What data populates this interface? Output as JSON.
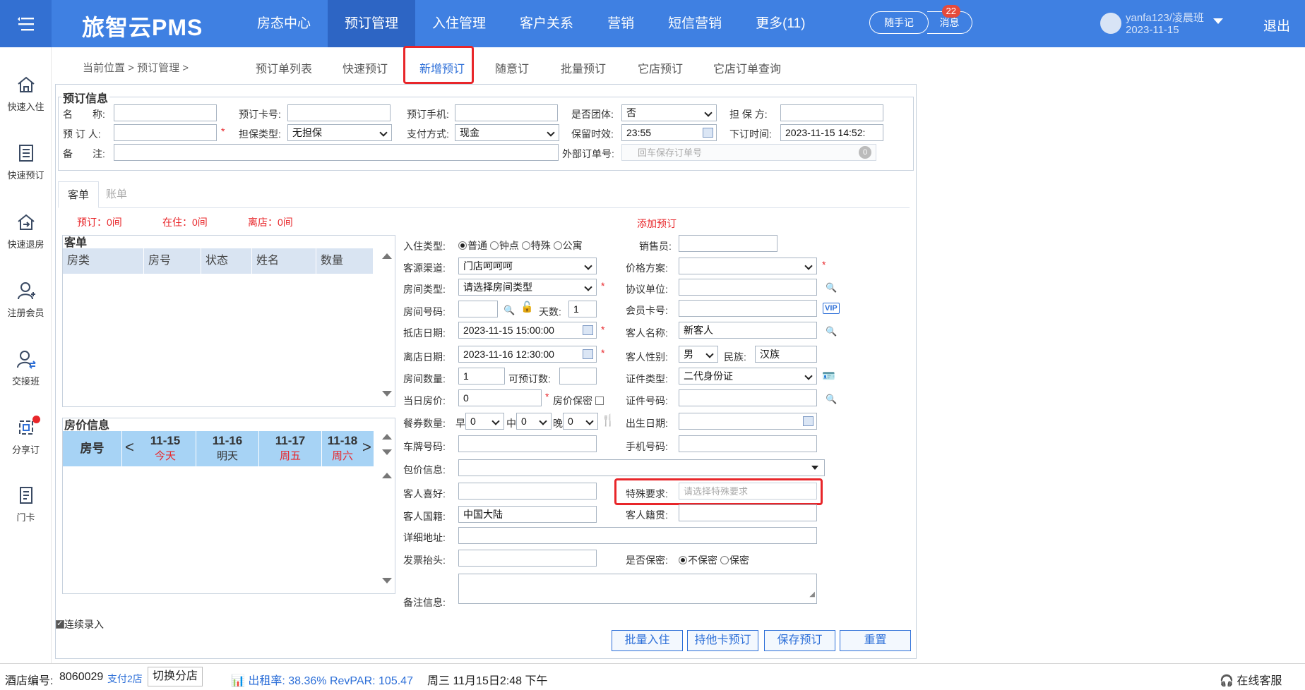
{
  "app": {
    "brand": "旅智云PMS",
    "nav": [
      "房态中心",
      "预订管理",
      "入住管理",
      "客户关系",
      "营销",
      "短信营销",
      "更多(11)"
    ],
    "active_nav": 1,
    "notes_btn": "随手记",
    "msg_btn": "消息",
    "msg_count": "22",
    "user_name": "yanfa123/凌晨班",
    "user_date": "2023-11-15",
    "logout": "退出"
  },
  "sidebar": [
    {
      "label": "快速入住",
      "icon": "home-icon"
    },
    {
      "label": "快速预订",
      "icon": "book-icon"
    },
    {
      "label": "快速退房",
      "icon": "checkout-icon"
    },
    {
      "label": "注册会员",
      "icon": "user-add-icon"
    },
    {
      "label": "交接班",
      "icon": "shift-icon"
    },
    {
      "label": "分享订",
      "icon": "share-icon"
    },
    {
      "label": "门卡",
      "icon": "card-icon"
    }
  ],
  "subnav": {
    "crumb": "当前位置 > 预订管理 >",
    "tabs": [
      "预订单列表",
      "快速预订",
      "新增预订",
      "随意订",
      "批量预订",
      "它店预订",
      "它店订单查询"
    ],
    "active": 2
  },
  "booking_info": {
    "legend": "预订信息",
    "name_label": "名　　称:",
    "card_label": "预订卡号:",
    "phone_label": "预订手机:",
    "group_label": "是否团体:",
    "group_value": "否",
    "guarantor_label": "担 保 方:",
    "booker_label": "预 订 人:",
    "guarantee_type_label": "担保类型:",
    "guarantee_type_value": "无担保",
    "payment_label": "支付方式:",
    "payment_value": "现金",
    "hold_label": "保留时效:",
    "hold_value": "23:55",
    "order_time_label": "下订时间:",
    "order_time_value": "2023-11-15 14:52:",
    "remark_label": "备　　注:",
    "external_label": "外部订单号:",
    "external_placeholder": "回车保存订单号",
    "external_count": "0"
  },
  "tabs": [
    "客单",
    "账单"
  ],
  "stats": {
    "reserved": "预订：0间",
    "in_house": "在住：0间",
    "departed": "离店：0间",
    "add_link": "添加预订"
  },
  "guest_list": {
    "title": "客单",
    "columns": [
      "房类",
      "房号",
      "状态",
      "姓名",
      "数量"
    ]
  },
  "price_info": {
    "title": "房价信息",
    "room_no": "房号",
    "days": [
      {
        "date": "11-15",
        "sub": "今天",
        "red": true
      },
      {
        "date": "11-16",
        "sub": "明天",
        "red": false
      },
      {
        "date": "11-17",
        "sub": "周五",
        "red": true
      },
      {
        "date": "11-18",
        "sub": "周六",
        "red": true
      }
    ]
  },
  "form": {
    "checkin_type_label": "入住类型:",
    "checkin_types": [
      "普通",
      "钟点",
      "特殊",
      "公寓"
    ],
    "checkin_type_selected": 0,
    "sales_label": "销售员:",
    "source_label": "客源渠道:",
    "source_value": "门店呵呵呵",
    "price_plan_label": "价格方案:",
    "room_type_label": "房间类型:",
    "room_type_value": "请选择房间类型",
    "agreement_label": "协议单位:",
    "room_no_label": "房间号码:",
    "days_label": "天数:",
    "days_value": "1",
    "member_card_label": "会员卡号:",
    "vip": "VIP",
    "arrive_label": "抵店日期:",
    "arrive_value": "2023-11-15 15:00:00",
    "guest_name_label": "客人名称:",
    "guest_name_value": "新客人",
    "depart_label": "离店日期:",
    "depart_value": "2023-11-16 12:30:00",
    "gender_label": "客人性别:",
    "gender_value": "男",
    "ethnic_label": "民族:",
    "ethnic_value": "汉族",
    "room_count_label": "房间数量:",
    "room_count_value": "1",
    "bookable_label": "可预订数:",
    "id_type_label": "证件类型:",
    "id_type_value": "二代身份证",
    "day_price_label": "当日房价:",
    "day_price_value": "0",
    "price_secret_label": "房价保密",
    "id_no_label": "证件号码:",
    "meal_label": "餐券数量:",
    "meal_breakfast": "早",
    "meal_lunch": "中",
    "meal_dinner": "晚",
    "meal_values": [
      "0",
      "0",
      "0"
    ],
    "birth_label": "出生日期:",
    "plate_label": "车牌号码:",
    "mobile_label": "手机号码:",
    "package_label": "包价信息:",
    "hobby_label": "客人喜好:",
    "special_label": "特殊要求:",
    "special_placeholder": "请选择特殊要求",
    "nationality_label": "客人国籍:",
    "nationality_value": "中国大陆",
    "origin_label": "客人籍贯:",
    "address_label": "详细地址:",
    "invoice_label": "发票抬头:",
    "secret_label": "是否保密:",
    "secret_options": [
      "不保密",
      "保密"
    ],
    "secret_selected": 0,
    "memo_label": "备注信息:"
  },
  "continuous": "连续录入",
  "buttons": [
    "批量入住",
    "持他卡预订",
    "保存预订",
    "重置"
  ],
  "footer": {
    "hotel_label": "酒店编号:",
    "hotel_no": "8060029",
    "branch_link": "支付2店",
    "switch_btn": "切换分店",
    "occupancy": "出租率: 38.36% RevPAR: 105.47",
    "datetime": "周三 11月15日2:48 下午",
    "service": "在线客服"
  },
  "colors": {
    "primary": "#3f80e2",
    "active_nav": "#2d65c4",
    "highlight_red": "#e8262a",
    "link_blue": "#2d6fd8"
  }
}
